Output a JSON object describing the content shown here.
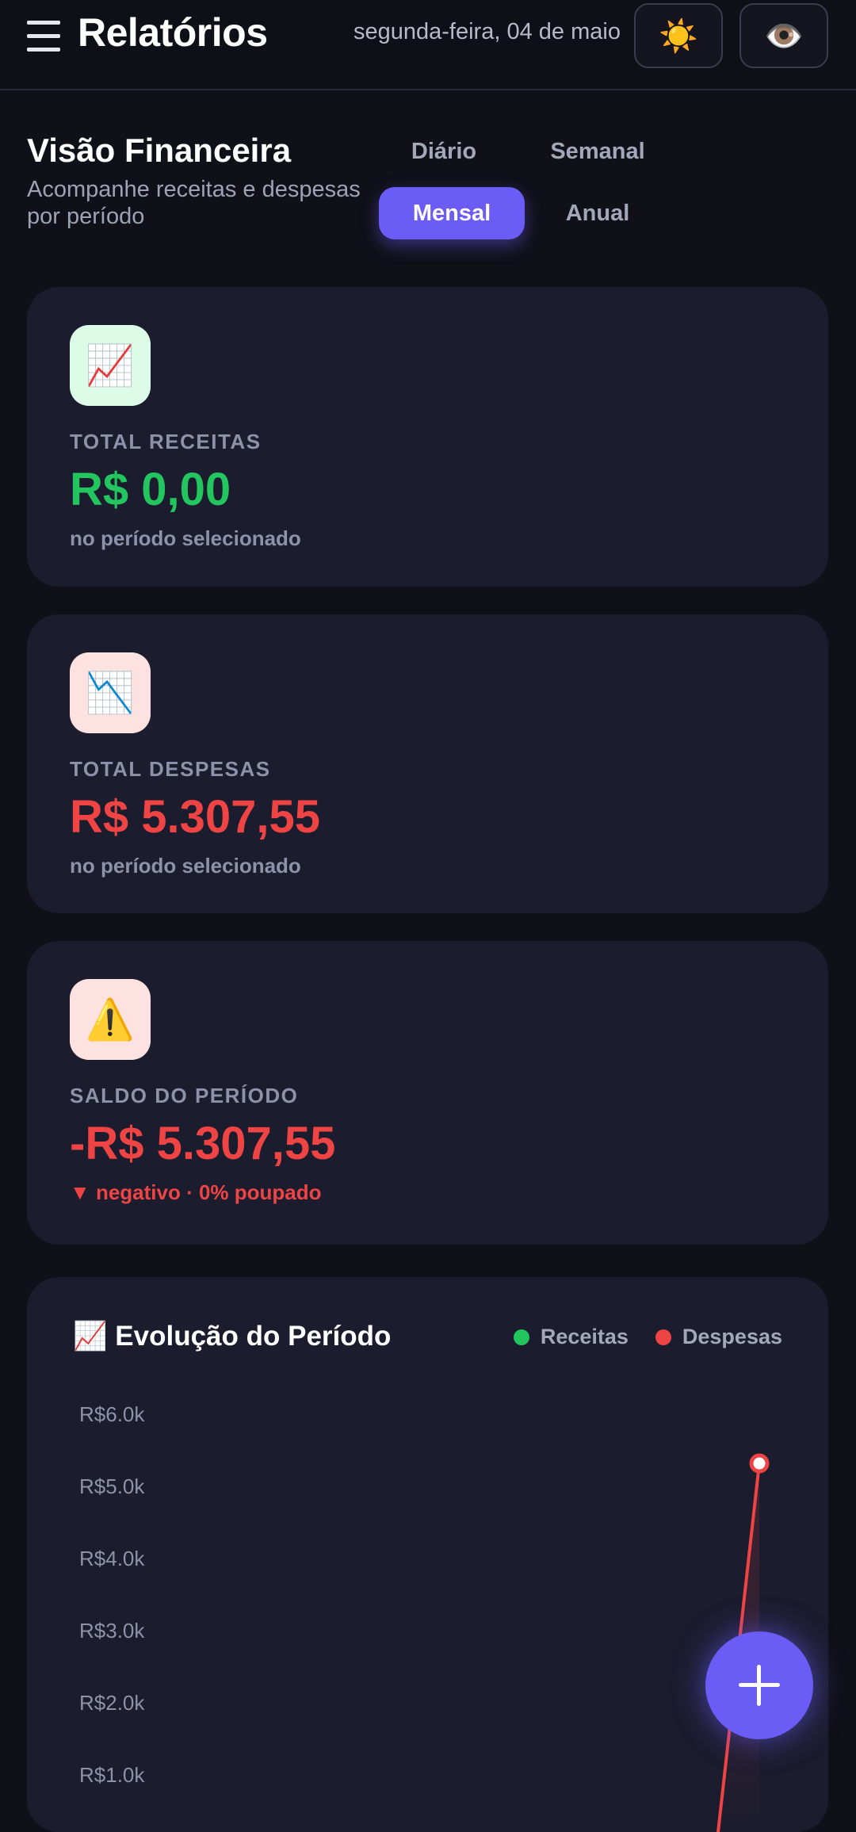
{
  "header": {
    "title": "Relatórios",
    "date": "segunda-feira, 04 de maio",
    "theme_icon": "☀️",
    "visibility_icon": "👁️"
  },
  "overview": {
    "title": "Visão Financeira",
    "subtitle": "Acompanhe receitas e despesas por período",
    "tabs": [
      {
        "label": "Diário"
      },
      {
        "label": "Semanal"
      },
      {
        "label": "Mensal",
        "active": true
      },
      {
        "label": "Anual"
      }
    ]
  },
  "cards": {
    "receitas": {
      "icon": "📈",
      "label": "TOTAL RECEITAS",
      "value": "R$ 0,00",
      "note": "no período selecionado",
      "color": "#22c55e",
      "icon_bg": "#dcfce7"
    },
    "despesas": {
      "icon": "📉",
      "label": "TOTAL DESPESAS",
      "value": "R$ 5.307,55",
      "note": "no período selecionado",
      "color": "#ef4444",
      "icon_bg": "#fee2e2"
    },
    "saldo": {
      "icon": "⚠️",
      "label": "SALDO DO PERÍODO",
      "value": "-R$ 5.307,55",
      "note": "▼ negativo · 0% poupado",
      "color": "#ef4444",
      "icon_bg": "#fee2e2"
    }
  },
  "chart": {
    "title": "📈 Evolução do Período",
    "legend": [
      {
        "name": "Receitas",
        "color": "#22c55e"
      },
      {
        "name": "Despesas",
        "color": "#ef4444"
      }
    ]
  },
  "chart_data": {
    "type": "line",
    "ylabel": "",
    "y_ticks": [
      "R$6.0k",
      "R$5.0k",
      "R$4.0k",
      "R$3.0k",
      "R$2.0k",
      "R$1.0k"
    ],
    "ylim": [
      0,
      6000
    ],
    "series": [
      {
        "name": "Despesas",
        "color": "#ef4444",
        "values": [
          0,
          5307.55
        ]
      }
    ]
  },
  "fab": {
    "icon": "plus-icon"
  }
}
